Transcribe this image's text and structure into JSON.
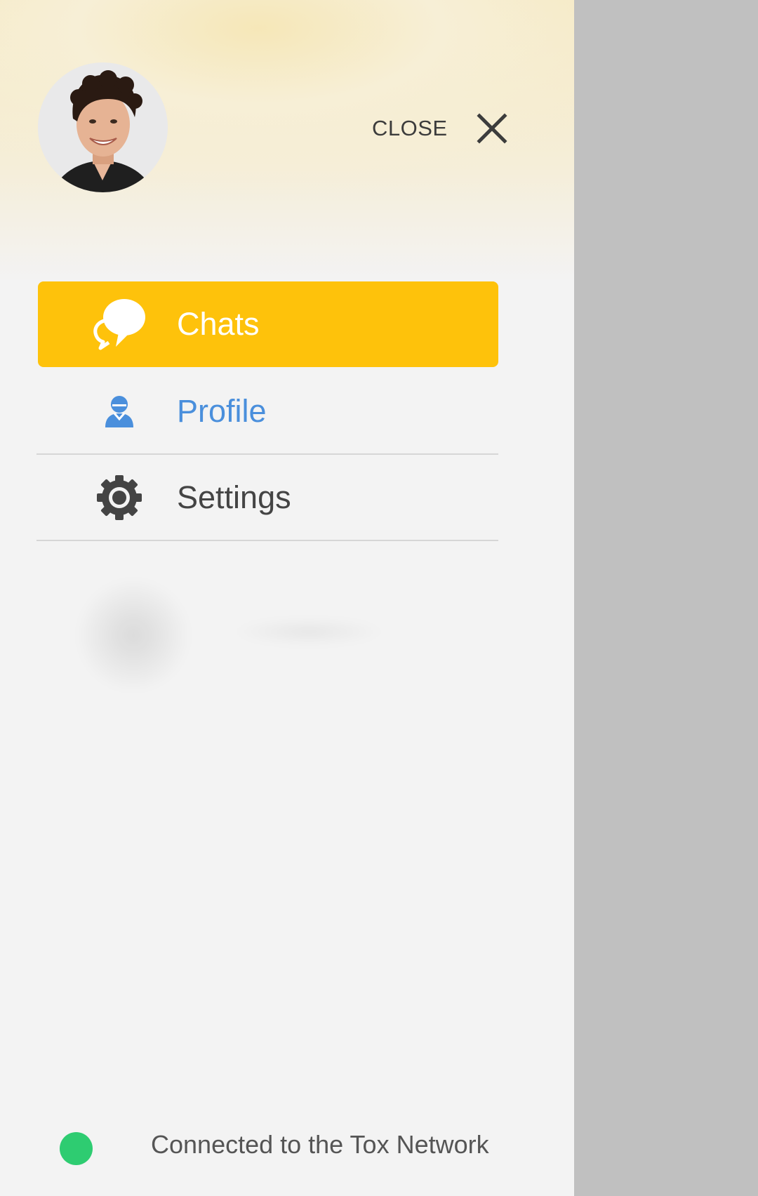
{
  "drawer": {
    "close_label": "CLOSE",
    "avatar": {
      "icon": "user-avatar-photo"
    },
    "nav_items": [
      {
        "label": "Chats",
        "icon": "chat-bubbles-icon",
        "active": true,
        "color": "#fec20b"
      },
      {
        "label": "Profile",
        "icon": "person-icon",
        "active": false,
        "color": "#4a8fdc"
      },
      {
        "label": "Settings",
        "icon": "gear-icon",
        "active": false,
        "color": "#444444"
      }
    ]
  },
  "status": {
    "text": "Connected to the Tox Network",
    "indicator_color": "#2ecc71"
  },
  "overlay": {
    "color": "#c0c0c0"
  }
}
